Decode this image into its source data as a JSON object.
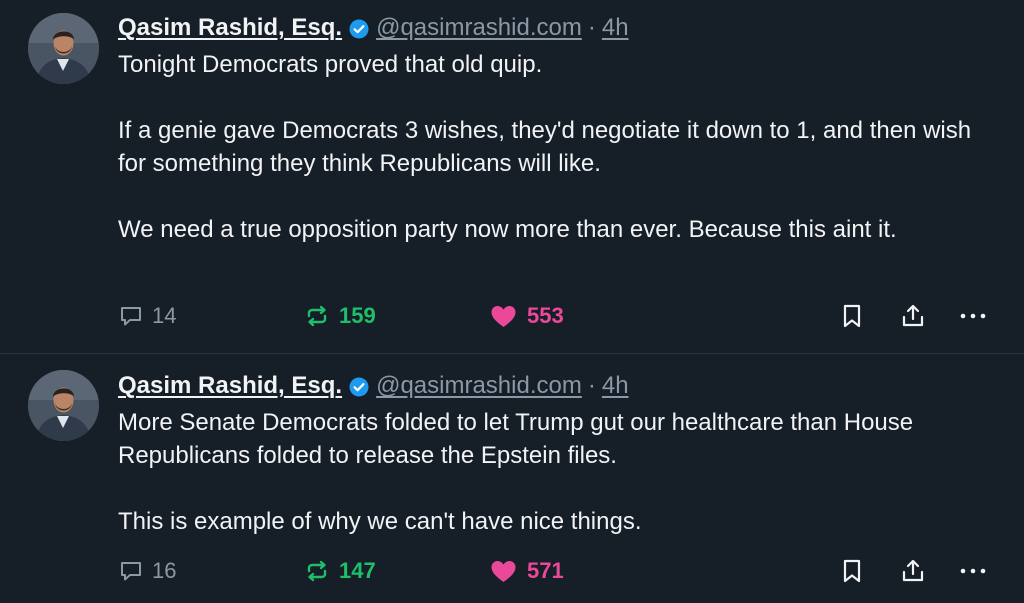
{
  "colors": {
    "background": "#161e27",
    "verified": "#1d9bf0",
    "repost": "#1fbf6a",
    "like": "#ec4899",
    "muted": "#8b98a5"
  },
  "icons": {
    "verified": "verified-badge-icon",
    "reply": "reply-bubble-icon",
    "repost": "repost-icon",
    "like": "heart-icon",
    "bookmark": "bookmark-icon",
    "share": "share-icon",
    "more": "more-dots-icon"
  },
  "posts": [
    {
      "author": {
        "name": "Qasim Rashid, Esq.",
        "handle": "@qasimrashid.com",
        "separator": "·",
        "time": "4h"
      },
      "paragraphs": [
        "Tonight Democrats proved that old quip.",
        "If a genie gave Democrats 3 wishes, they'd negotiate it down to 1, and then wish for something they think Republicans will like.",
        "We need a true opposition party now more than ever. Because this aint it."
      ],
      "stats": {
        "replies": "14",
        "reposts": "159",
        "likes": "553"
      }
    },
    {
      "author": {
        "name": "Qasim Rashid, Esq.",
        "handle": "@qasimrashid.com",
        "separator": "·",
        "time": "4h"
      },
      "paragraphs": [
        "More Senate Democrats folded to let Trump gut our healthcare than House Republicans folded to release the Epstein files.",
        "This is example of why we can't have nice things."
      ],
      "stats": {
        "replies": "16",
        "reposts": "147",
        "likes": "571"
      }
    }
  ]
}
